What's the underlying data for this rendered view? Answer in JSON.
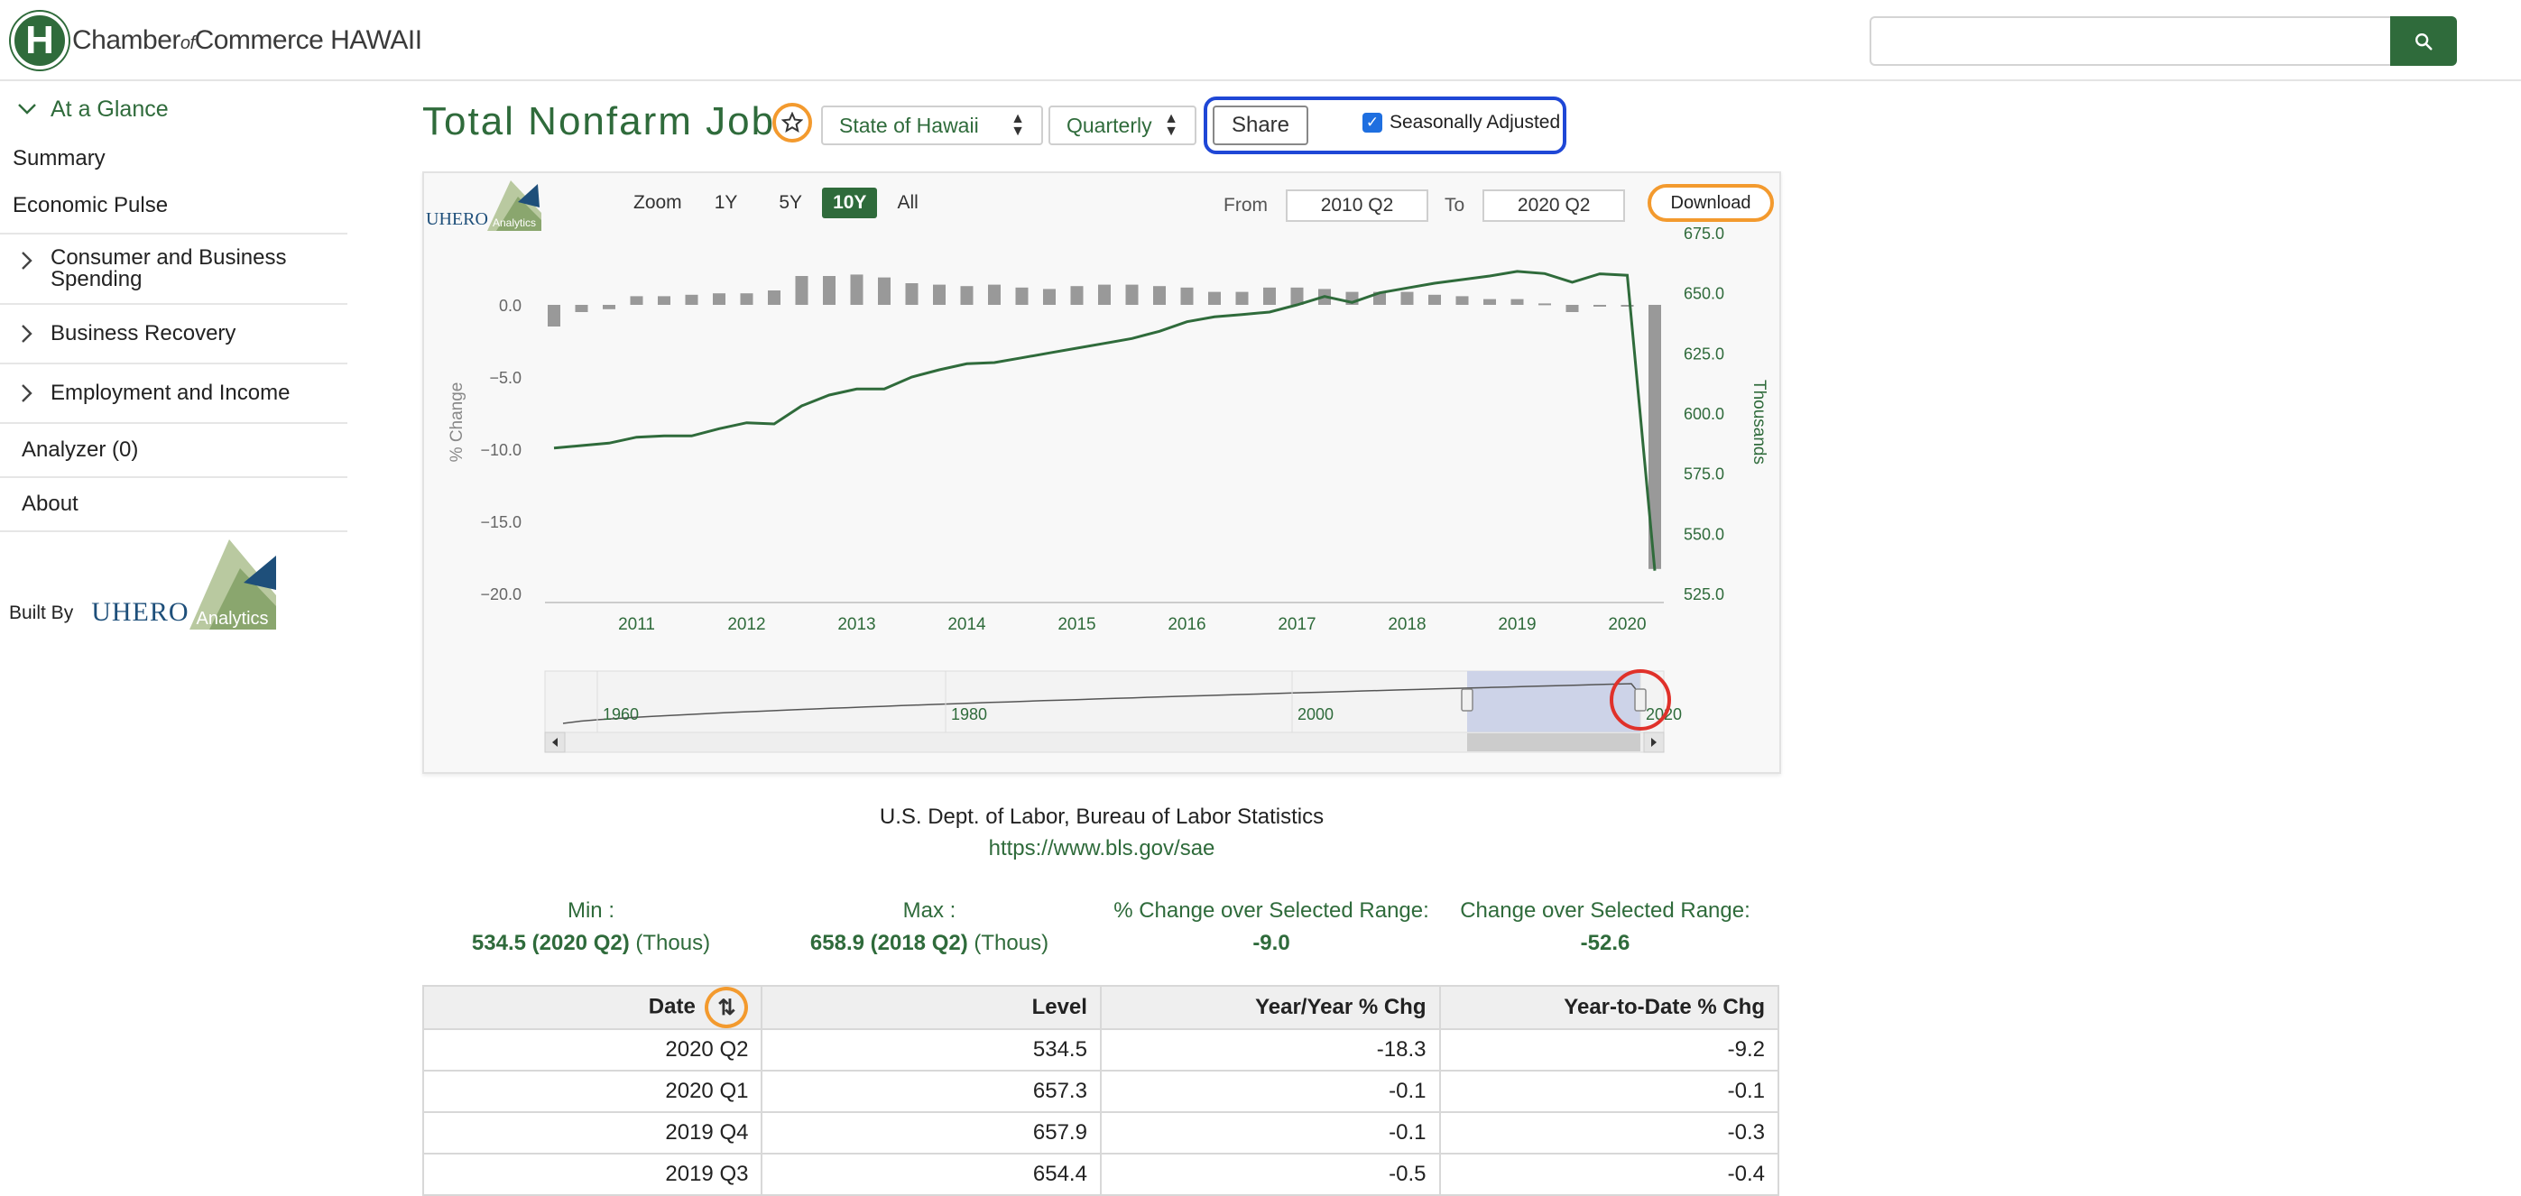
{
  "header": {
    "logo_letter": "H",
    "logo_name_part1": "Chamber",
    "logo_name_of": "of",
    "logo_name_part2": "Commerce HAWAII",
    "search_placeholder": ""
  },
  "sidebar": {
    "at_a_glance": "At a Glance",
    "summary": "Summary",
    "economic_pulse": "Economic Pulse",
    "groups": [
      {
        "line1": "Consumer and Business",
        "line2": "Spending"
      },
      {
        "line1": "Business Recovery"
      },
      {
        "line1": "Employment and Income"
      }
    ],
    "analyzer": "Analyzer (0)",
    "about": "About",
    "built_by": "Built By"
  },
  "uhero": {
    "word": "UHERO",
    "analytics": "Analytics"
  },
  "main": {
    "title": "Total Nonfarm Jobs",
    "geo_select": "State of Hawaii",
    "freq_select": "Quarterly",
    "share": "Share",
    "seasonally_adjusted": "Seasonally Adjusted",
    "seasonally_adjusted_checked": true
  },
  "chart_controls": {
    "zoom_label": "Zoom",
    "zoom_options": [
      "1Y",
      "5Y",
      "10Y",
      "All"
    ],
    "zoom_active": "10Y",
    "from_label": "From",
    "from_value": "2010 Q2",
    "to_label": "To",
    "to_value": "2020 Q2",
    "download": "Download"
  },
  "chart_data": {
    "type": "line",
    "x": [
      "2010 Q2",
      "2010 Q3",
      "2010 Q4",
      "2011 Q1",
      "2011 Q2",
      "2011 Q3",
      "2011 Q4",
      "2012 Q1",
      "2012 Q2",
      "2012 Q3",
      "2012 Q4",
      "2013 Q1",
      "2013 Q2",
      "2013 Q3",
      "2013 Q4",
      "2014 Q1",
      "2014 Q2",
      "2014 Q3",
      "2014 Q4",
      "2015 Q1",
      "2015 Q2",
      "2015 Q3",
      "2015 Q4",
      "2016 Q1",
      "2016 Q2",
      "2016 Q3",
      "2016 Q4",
      "2017 Q1",
      "2017 Q2",
      "2017 Q3",
      "2017 Q4",
      "2018 Q1",
      "2018 Q2",
      "2018 Q3",
      "2018 Q4",
      "2019 Q1",
      "2019 Q2",
      "2019 Q3",
      "2019 Q4",
      "2020 Q1",
      "2020 Q2"
    ],
    "series": [
      {
        "axis": "right",
        "color": "#2f6b3b",
        "values": [
          585.5,
          586.5,
          587.5,
          590.0,
          590.5,
          590.5,
          593.5,
          596.0,
          595.5,
          603.0,
          607.5,
          610.0,
          610.0,
          615.0,
          618.0,
          620.5,
          621.0,
          623.0,
          625.0,
          627.0,
          629.0,
          631.0,
          634.0,
          638.0,
          640.0,
          641.0,
          642.0,
          645.0,
          648.5,
          646.0,
          650.0,
          652.0,
          654.0,
          655.5,
          657.0,
          658.9,
          658.0,
          654.4,
          657.9,
          657.3,
          534.5
        ]
      },
      {
        "axis": "left",
        "color": "#999999",
        "values": [
          -1.5,
          -0.5,
          -0.3,
          0.6,
          0.6,
          0.7,
          0.8,
          0.8,
          1.0,
          2.0,
          2.0,
          2.1,
          1.9,
          1.5,
          1.4,
          1.3,
          1.4,
          1.2,
          1.1,
          1.3,
          1.4,
          1.4,
          1.3,
          1.2,
          0.9,
          0.9,
          1.2,
          1.2,
          1.1,
          0.9,
          0.9,
          0.9,
          0.7,
          0.6,
          0.4,
          0.4,
          0.1,
          -0.5,
          -0.1,
          -0.1,
          -18.3
        ]
      }
    ],
    "left_axis": {
      "label": "% Change",
      "ticks": [
        "0.0",
        "−5.0",
        "−10.0",
        "−15.0",
        "−20.0"
      ],
      "range": [
        -20,
        0
      ]
    },
    "right_axis": {
      "label": "Thousands",
      "ticks": [
        "675.0",
        "650.0",
        "625.0",
        "600.0",
        "575.0",
        "550.0",
        "525.0"
      ],
      "range": [
        525,
        675
      ]
    },
    "x_ticks": [
      "2011",
      "2012",
      "2013",
      "2014",
      "2015",
      "2016",
      "2017",
      "2018",
      "2019",
      "2020"
    ],
    "navigator_ticks": [
      "1960",
      "1980",
      "2000",
      "2020"
    ]
  },
  "source": {
    "org": "U.S. Dept. of Labor, Bureau of Labor Statistics",
    "url": "https://www.bls.gov/sae"
  },
  "stats": {
    "min_label": "Min :",
    "min_value": "534.5 (2020 Q2)",
    "min_unit": "(Thous)",
    "max_label": "Max :",
    "max_value": "658.9 (2018 Q2)",
    "max_unit": "(Thous)",
    "pct_change_label": "% Change over Selected Range:",
    "pct_change_value": "-9.0",
    "change_label": "Change over Selected Range:",
    "change_value": "-52.6"
  },
  "table": {
    "headers": [
      "Date",
      "Level",
      "Year/Year % Chg",
      "Year-to-Date % Chg"
    ],
    "rows": [
      [
        "2020 Q2",
        "534.5",
        "-18.3",
        "-9.2"
      ],
      [
        "2020 Q1",
        "657.3",
        "-0.1",
        "-0.1"
      ],
      [
        "2019 Q4",
        "657.9",
        "-0.1",
        "-0.3"
      ],
      [
        "2019 Q3",
        "654.4",
        "-0.5",
        "-0.4"
      ]
    ]
  }
}
